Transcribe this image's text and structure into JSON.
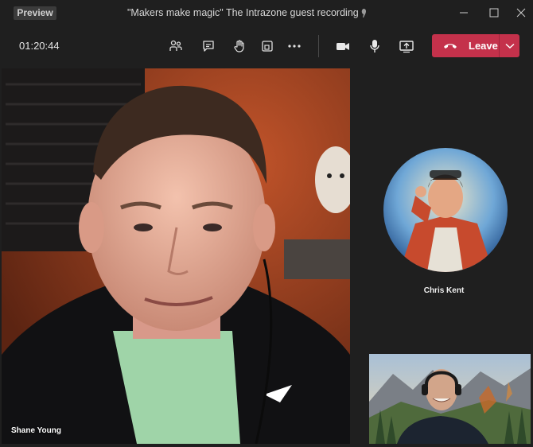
{
  "titlebar": {
    "badge": "Preview",
    "title": "\"Makers make magic\" The Intrazone guest recording"
  },
  "toolbar": {
    "timer": "01:20:44",
    "leave_label": "Leave"
  },
  "participants": {
    "main_name": "Shane Young",
    "avatar_name": "Chris Kent"
  },
  "colors": {
    "background": "#1f1f1f",
    "leave": "#c4314b"
  }
}
